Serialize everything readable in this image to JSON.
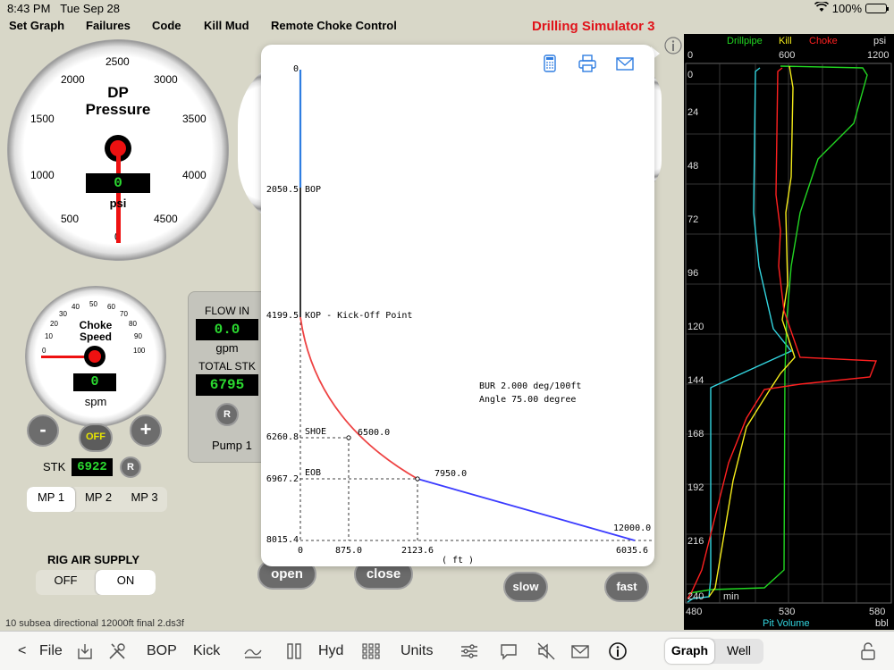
{
  "status": {
    "time": "8:43 PM",
    "date": "Tue Sep 28",
    "battery": "100%"
  },
  "menu": [
    "Set Graph",
    "Failures",
    "Code",
    "Kill Mud",
    "Remote Choke Control"
  ],
  "app_title": "Drilling Simulator 3",
  "dp_gauge": {
    "title_line1": "DP",
    "title_line2": "Pressure",
    "unit": "psi",
    "value": "0",
    "ticks": [
      "0",
      "500",
      "1000",
      "1500",
      "2000",
      "2500",
      "3000",
      "3500",
      "4000",
      "4500"
    ]
  },
  "choke_gauge": {
    "title_line1": "Choke",
    "title_line2": "Speed",
    "ticks": [
      "0",
      "10",
      "20",
      "30",
      "40",
      "50",
      "60",
      "70",
      "80",
      "90",
      "100"
    ],
    "value": "0",
    "unit": "spm"
  },
  "controls": {
    "minus": "-",
    "plus": "+",
    "off": "OFF",
    "stk_label": "STK",
    "stk_value": "6922",
    "reset": "R",
    "mp": [
      "MP 1",
      "MP 2",
      "MP 3"
    ],
    "rig_air_label": "RIG AIR SUPPLY",
    "air_off": "OFF",
    "air_on": "ON"
  },
  "flow": {
    "flow_in_label": "FLOW IN",
    "flow_in_value": "0.0",
    "flow_unit": "gpm",
    "total_stk_label": "TOTAL STK",
    "total_stk_value": "6795",
    "reset": "R",
    "pump_label": "Pump 1"
  },
  "buttons": {
    "open": "open",
    "close": "close",
    "slow": "slow",
    "fast": "fast"
  },
  "popup": {
    "icons": [
      "calculator-icon",
      "print-icon",
      "mail-icon"
    ]
  },
  "well_profile": {
    "depth_labels": [
      {
        "value": "0",
        "note": ""
      },
      {
        "value": "2050.5",
        "note": "BOP"
      },
      {
        "value": "4199.5",
        "note": "KOP - Kick-Off Point"
      },
      {
        "value": "6260.8",
        "note": "SHOE"
      },
      {
        "value": "6967.2",
        "note": "EOB"
      },
      {
        "value": "8015.4",
        "note": ""
      }
    ],
    "x_ticks": [
      "0",
      "875.0",
      "2123.6",
      "6035.6"
    ],
    "x_unit": "( ft )",
    "md_labels": [
      "6500.0",
      "7950.0",
      "12000.0"
    ],
    "bur_text": "BUR 2.000 deg/100ft",
    "angle_text": "Angle 75.00 degree",
    "colors": {
      "upper": "#2f7de1",
      "riser": "#000000",
      "build": "#ee4343",
      "tangent": "#3b3bff"
    }
  },
  "trend": {
    "legend": [
      {
        "name": "Drillpipe",
        "color": "#22d622"
      },
      {
        "name": "Kill",
        "color": "#f5ec1a"
      },
      {
        "name": "Choke",
        "color": "#ff2020"
      }
    ],
    "unit": "psi",
    "top_ticks": [
      "0",
      "600",
      "1200"
    ],
    "time_ticks": [
      "0",
      "24",
      "48",
      "72",
      "96",
      "120",
      "144",
      "168",
      "192",
      "216",
      "240"
    ],
    "time_unit": "min",
    "bottom_ticks": [
      "480",
      "530",
      "580"
    ],
    "bottom_label": "Pit Volume",
    "bottom_unit": "bbl"
  },
  "file_name": "10 subsea directional 12000ft final 2.ds3f",
  "toolbar": {
    "back": "<",
    "file": "File",
    "bop": "BOP",
    "kick": "Kick",
    "hyd": "Hyd",
    "units": "Units",
    "graph": "Graph",
    "well": "Well"
  }
}
